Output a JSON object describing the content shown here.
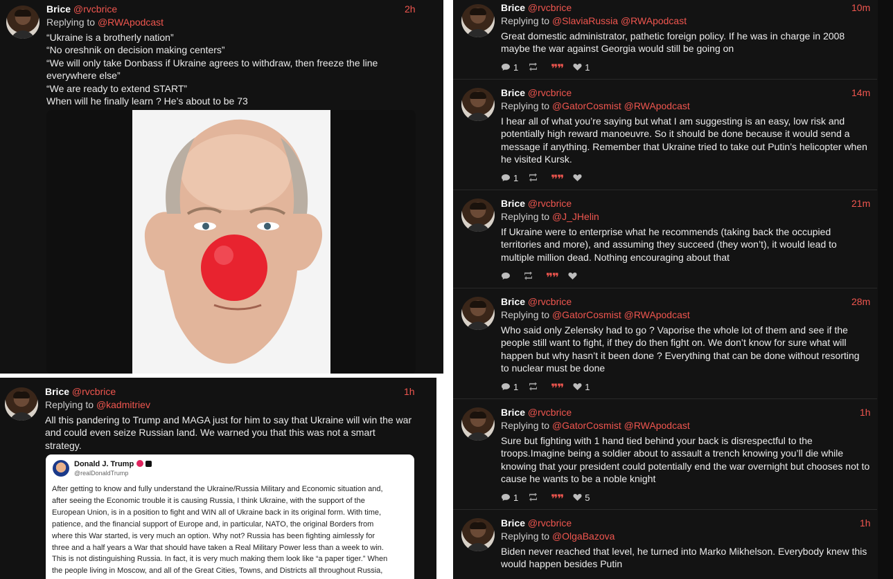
{
  "colors": {
    "accent": "#f0564f",
    "background": "#121212",
    "text": "#ececec"
  },
  "panel_a": {
    "post": {
      "name": "Brice",
      "handle": "@rvcbrice",
      "time": "2h",
      "replying_label": "Replying to",
      "replying_to": "@RWApodcast",
      "lines": [
        "“Ukraine is a brotherly nation”",
        "“No oreshnik on decision making centers”",
        "“We will only take Donbass if Ukraine agrees to withdraw, then freeze the line",
        "everywhere else”",
        "“We are ready to extend START”",
        "When will he finally learn ? He’s about to be 73"
      ],
      "media_icon": "clown-nose-portrait-image"
    }
  },
  "panel_b": {
    "post": {
      "name": "Brice",
      "handle": "@rvcbrice",
      "time": "1h",
      "replying_label": "Replying to",
      "replying_to": "@kadmitriev",
      "lines": [
        "All this pandering to Trump and MAGA just for him to say that Ukraine will win the war",
        "and could even seize Russian land. We warned you that this was not a smart",
        "strategy."
      ],
      "embed": {
        "name": "Donald J. Trump",
        "handle": "@realDonaldTrump",
        "lines": [
          "After getting to know and fully understand the Ukraine/Russia Military and Economic situation and,",
          "after seeing the Economic trouble it is causing Russia, I think Ukraine, with the support of the",
          "European Union, is in a position to fight and WIN all of Ukraine back in its original form. With time,",
          "patience, and the financial support of Europe and, in particular, NATO, the original Borders from",
          "where this War started, is very much an option. Why not? Russia has been fighting aimlessly for",
          "three and a half years a War that should have taken a Real Military Power less than a week to win.",
          "This is not distinguishing Russia. In fact, it is very much making them look like “a paper tiger.” When",
          "the people living in Moscow, and all of the Great Cities, Towns, and Districts all throughout Russia,"
        ]
      }
    }
  },
  "panel_c": {
    "posts": [
      {
        "name": "Brice",
        "handle": "@rvcbrice",
        "time": "10m",
        "replying_label": "Replying to",
        "replying_to": "@SlaviaRussia @RWApodcast",
        "lines": [
          "Great domestic administrator, pathetic foreign policy. If he was in charge in 2008",
          "maybe the war against Georgia would still be going on"
        ],
        "replies": "1",
        "reposts": "",
        "likes": "1"
      },
      {
        "name": "Brice",
        "handle": "@rvcbrice",
        "time": "14m",
        "replying_label": "Replying to",
        "replying_to": "@GatorCosmist @RWApodcast",
        "lines": [
          "I hear all of what you’re saying but what I am suggesting is an easy, low risk and",
          "potentially high reward manoeuvre. So it should be done because it would send a",
          "message if anything. Remember that Ukraine tried to take out Putin’s helicopter when",
          "he visited Kursk."
        ],
        "replies": "1",
        "reposts": "",
        "likes": ""
      },
      {
        "name": "Brice",
        "handle": "@rvcbrice",
        "time": "21m",
        "replying_label": "Replying to",
        "replying_to": "@J_JHelin",
        "lines": [
          "If Ukraine were to enterprise what he recommends (taking back the occupied",
          "territories and more), and assuming they succeed (they won’t), it would lead to",
          "multiple million dead. Nothing encouraging about that"
        ],
        "replies": "",
        "reposts": "",
        "likes": ""
      },
      {
        "name": "Brice",
        "handle": "@rvcbrice",
        "time": "28m",
        "replying_label": "Replying to",
        "replying_to": "@GatorCosmist @RWApodcast",
        "lines": [
          "Who said only Zelensky had to go ? Vaporise the whole lot of them and see if the",
          "people still want to fight, if they do then fight on. We don’t know for sure what will",
          "happen but why hasn’t it been done ? Everything that can be done without resorting",
          "to nuclear must be done"
        ],
        "replies": "1",
        "reposts": "",
        "likes": "1"
      },
      {
        "name": "Brice",
        "handle": "@rvcbrice",
        "time": "1h",
        "replying_label": "Replying to",
        "replying_to": "@GatorCosmist @RWApodcast",
        "lines": [
          "Sure but fighting with 1 hand tied behind your back is disrespectful to the",
          "troops.Imagine being a soldier about to assault a trench knowing you’ll die while",
          "knowing that your president could potentially end the war overnight but chooses not to",
          "cause he wants to be a noble knight"
        ],
        "replies": "1",
        "reposts": "",
        "likes": "5"
      },
      {
        "name": "Brice",
        "handle": "@rvcbrice",
        "time": "1h",
        "replying_label": "Replying to",
        "replying_to": "@OlgaBazova",
        "lines": [
          "Biden never reached that level, he turned into Marko Mikhelson. Everybody knew this",
          "would happen besides Putin"
        ],
        "replies": "",
        "reposts": "",
        "likes": ""
      }
    ]
  }
}
